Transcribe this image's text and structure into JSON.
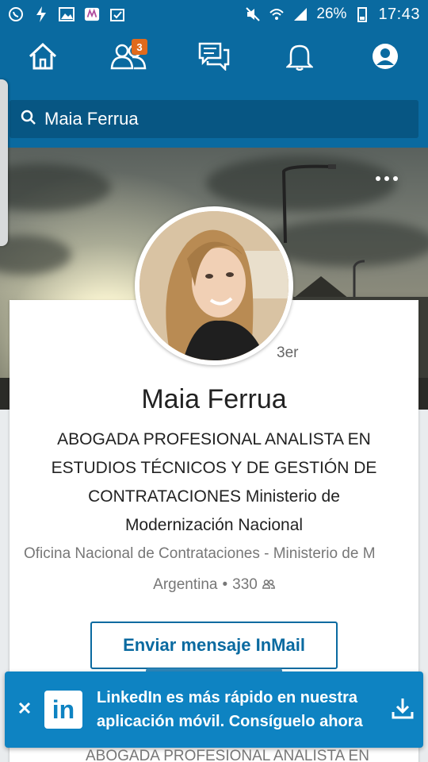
{
  "status_bar": {
    "battery": "26%",
    "time": "17:43"
  },
  "nav": {
    "items": [
      {
        "name": "home",
        "icon": "home-icon"
      },
      {
        "name": "network",
        "icon": "people-icon",
        "badge": "3"
      },
      {
        "name": "messages",
        "icon": "messages-icon"
      },
      {
        "name": "notifications",
        "icon": "bell-icon"
      },
      {
        "name": "profile",
        "icon": "profile-icon"
      }
    ]
  },
  "search": {
    "query": "Maia Ferrua"
  },
  "profile": {
    "degree": "3er",
    "name": "Maia Ferrua",
    "headline": "ABOGADA PROFESIONAL ANALISTA EN ESTUDIOS TÉCNICOS Y DE GESTIÓN DE CONTRATACIONES Ministerio de Modernización Nacional",
    "company": "Oficina Nacional de Contrataciones - Ministerio de M",
    "location": "Argentina",
    "separator": "•",
    "connections": "330"
  },
  "actions": {
    "inmail_label": "Enviar mensaje InMail"
  },
  "banner": {
    "logo": "in",
    "text": "LinkedIn es más rápido en nuestra aplicación móvil. Consíguelo ahora"
  },
  "peek": {
    "text": "ABOGADA PROFESIONAL ANALISTA EN"
  },
  "colors": {
    "brand": "#0a6aa0",
    "banner": "#0e83c2",
    "badge": "#e06a1c"
  }
}
